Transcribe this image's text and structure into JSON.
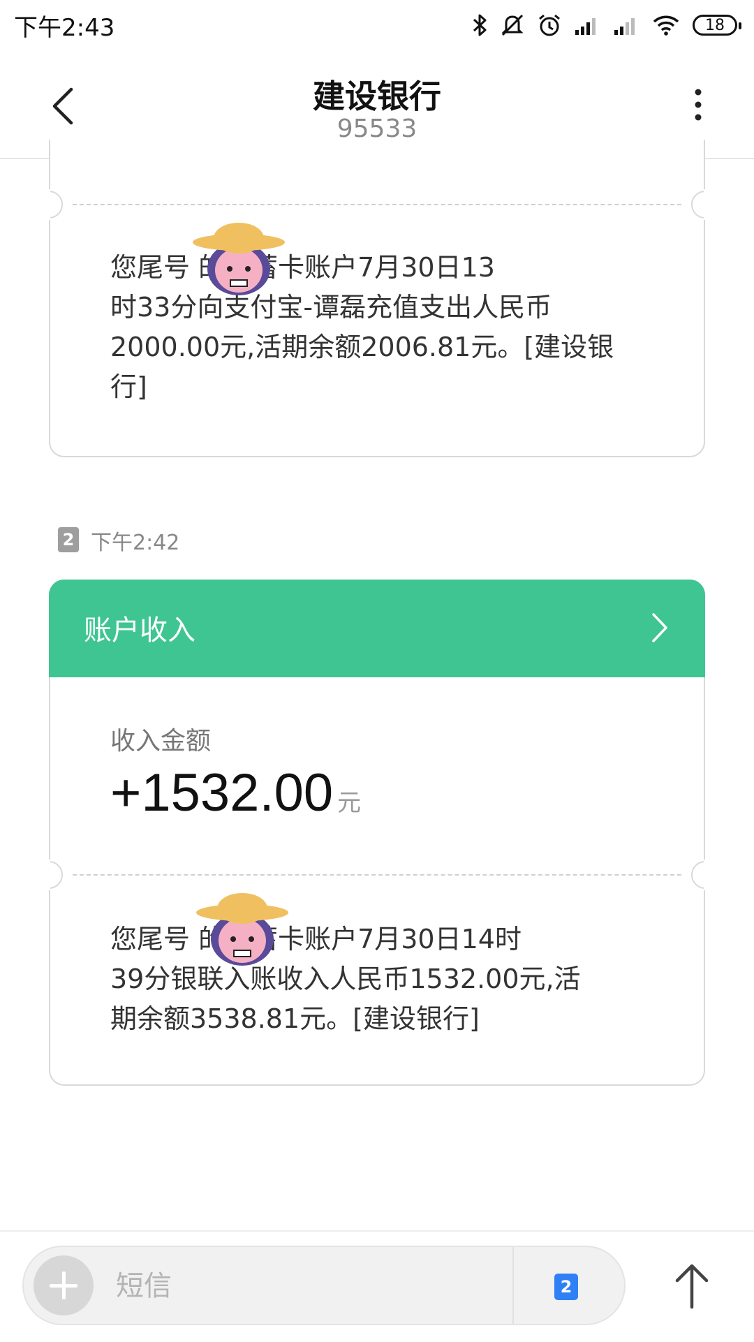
{
  "status_bar": {
    "time": "下午2:43",
    "battery": "18"
  },
  "header": {
    "title": "建设银行",
    "number": "95533"
  },
  "messages": [
    {
      "text": "您尾号 的储蓄卡账户7月30日13时33分向支付宝-谭磊充值支出人民币2000.00元,活期余额2006.81元。[建设银行]",
      "lines": [
        "您尾号      的储蓄卡账户7月30日13",
        "时33分向支付宝-谭磊充值支出人民币",
        "2000.00元,活期余额2006.81元。[建设银",
        "行]"
      ]
    },
    {
      "sim": "2",
      "time": "下午2:42",
      "card_title": "账户收入",
      "income_label": "收入金额",
      "income_amount": "+1532.00",
      "income_unit": "元",
      "lines": [
        "您尾号      的储蓄卡账户7月30日14时",
        "39分银联入账收入人民币1532.00元,活",
        "期余额3538.81元。[建设银行]"
      ]
    }
  ],
  "input_bar": {
    "placeholder": "短信",
    "sim": "2"
  },
  "colors": {
    "card_header": "#3ec592",
    "sim_blue": "#2f7ff5"
  },
  "icons": [
    "bluetooth-icon",
    "mute-icon",
    "alarm-icon",
    "signal-icon",
    "wifi-icon",
    "back-icon",
    "more-icon",
    "chevron-right-icon",
    "send-arrow-icon"
  ]
}
